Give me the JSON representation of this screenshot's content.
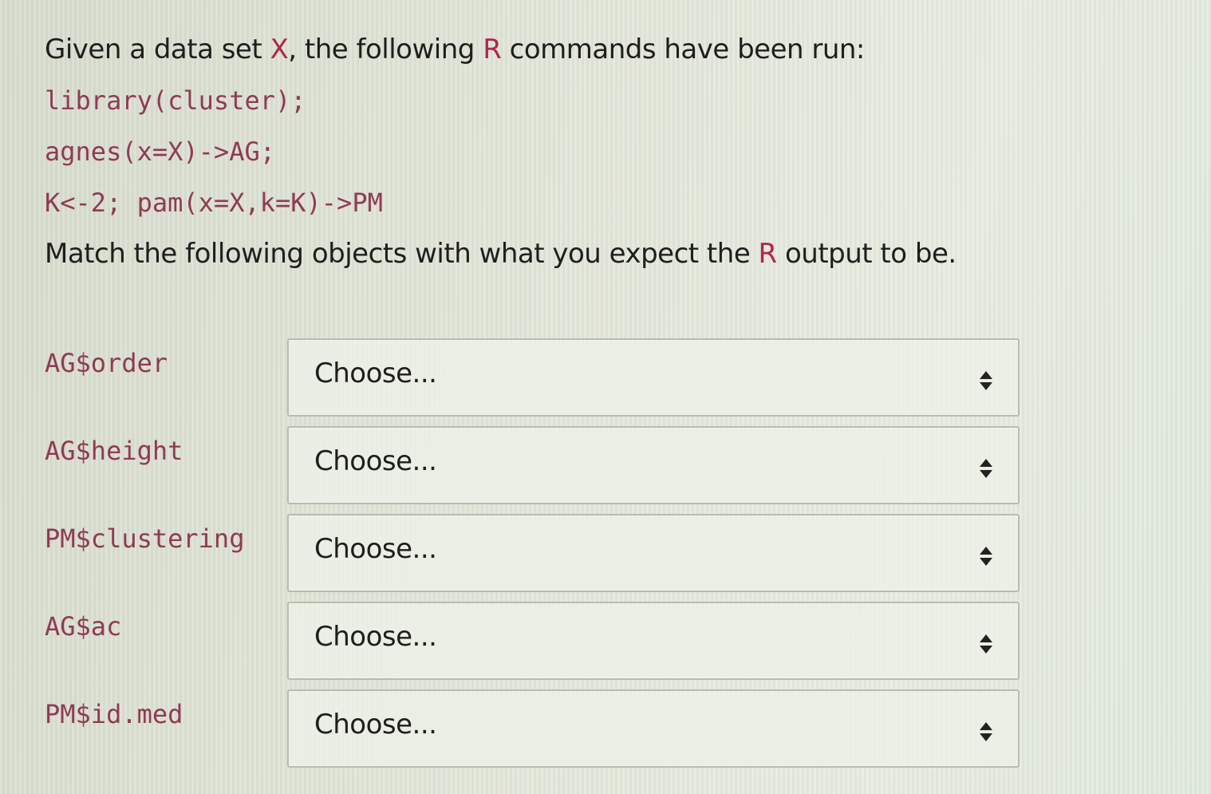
{
  "question": {
    "intro_before_x": "Given a data set ",
    "intro_x": "X",
    "intro_middle": ", the following ",
    "intro_r": "R",
    "intro_after": " commands have been run:",
    "code_lines": [
      "library(cluster);",
      "agnes(x=X)->AG;",
      "K<-2; pam(x=X,k=K)->PM"
    ],
    "match_before_r": "Match the following objects with what you expect the ",
    "match_r": "R",
    "match_after": " output to be."
  },
  "rows": [
    {
      "label": "AG$order",
      "selected": "Choose..."
    },
    {
      "label": "AG$height",
      "selected": "Choose..."
    },
    {
      "label": "PM$clustering",
      "selected": "Choose..."
    },
    {
      "label": "AG$ac",
      "selected": "Choose..."
    },
    {
      "label": "PM$id.med",
      "selected": "Choose..."
    }
  ],
  "icons": {
    "select_caret": "up-down-caret-icon"
  },
  "colors": {
    "code_text": "#8e3b55",
    "accent": "#b0264f",
    "body_text": "#1e1e1e"
  }
}
